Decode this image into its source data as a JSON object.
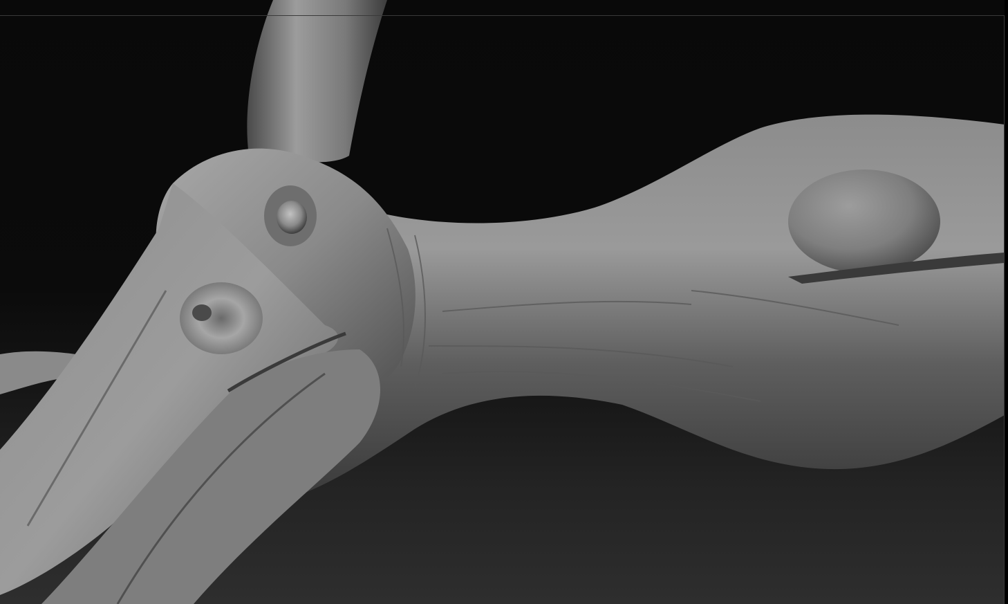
{
  "viewport": {
    "background_top": "#090909",
    "background_bottom": "#2e2e2e",
    "frame_line_color": "#3a3a3a"
  },
  "model": {
    "material_color": "#8a8a8a",
    "subject": "pterosaur-head-sculpt"
  }
}
